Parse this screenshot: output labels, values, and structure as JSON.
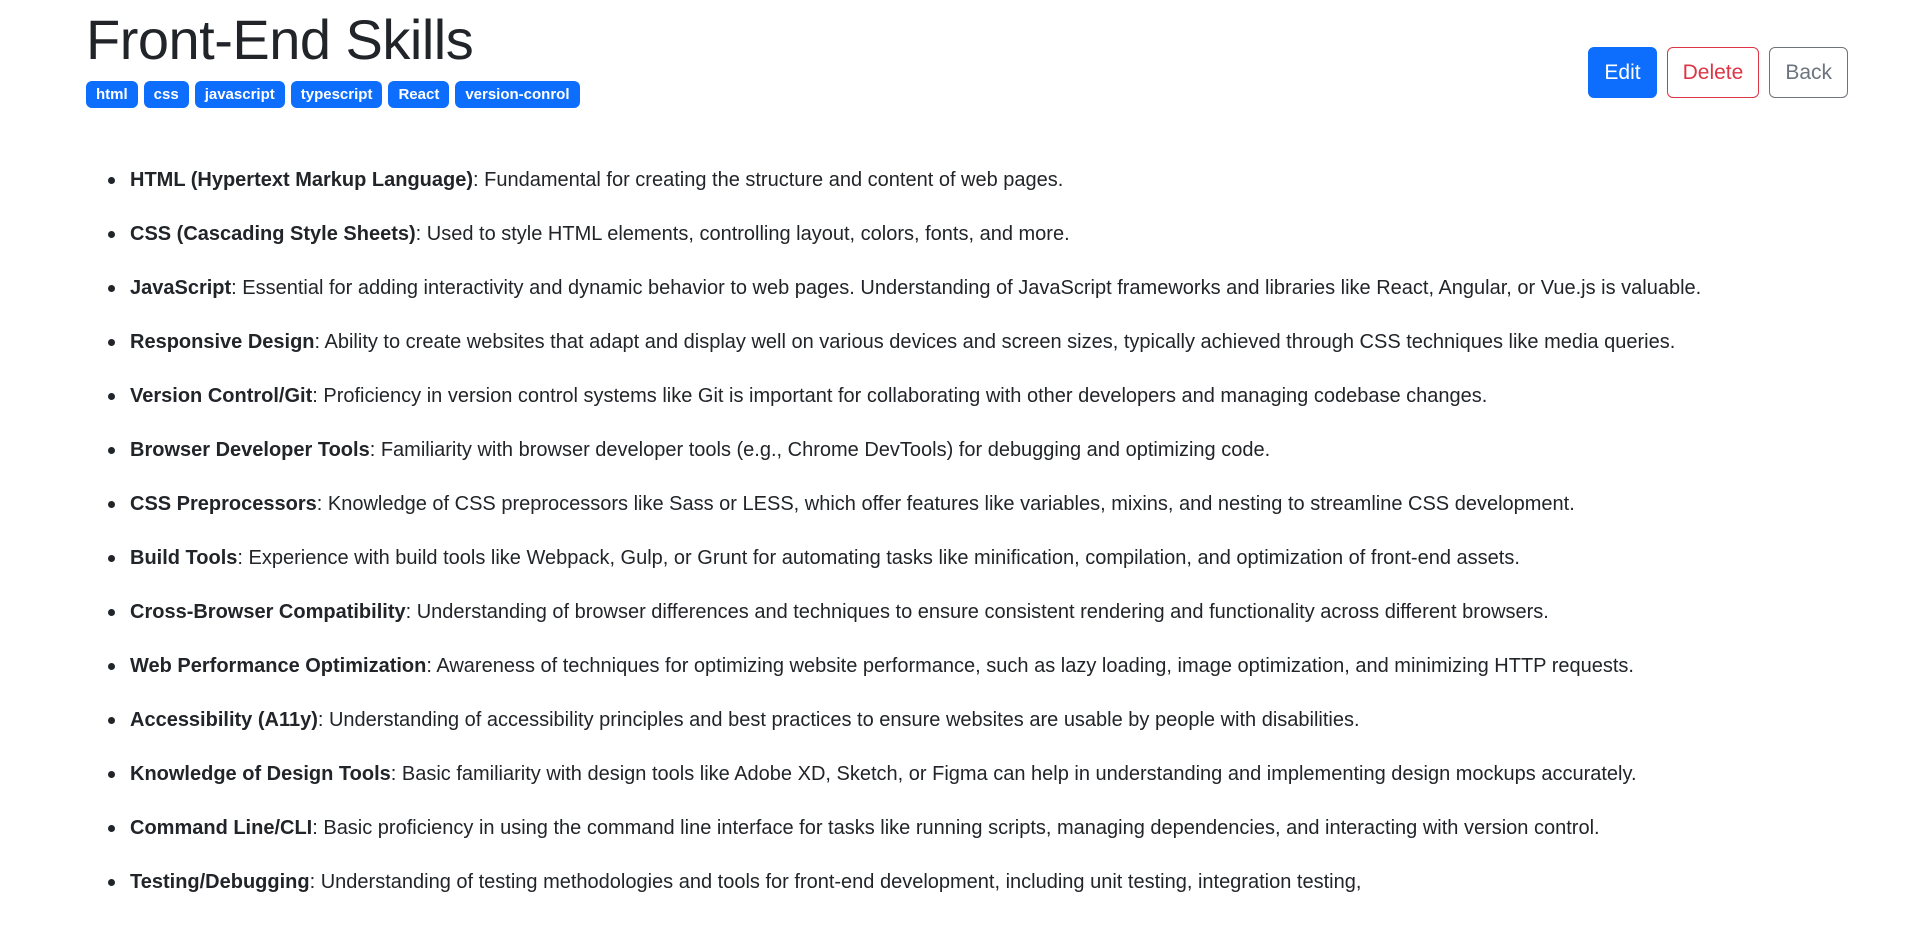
{
  "page": {
    "title": "Front-End Skills",
    "tags": [
      "html",
      "css",
      "javascript",
      "typescript",
      "React",
      "version-conrol"
    ]
  },
  "actions": {
    "edit_label": "Edit",
    "delete_label": "Delete",
    "back_label": "Back"
  },
  "skills": [
    {
      "name": "HTML (Hypertext Markup Language)",
      "description": ": Fundamental for creating the structure and content of web pages."
    },
    {
      "name": "CSS (Cascading Style Sheets)",
      "description": ": Used to style HTML elements, controlling layout, colors, fonts, and more."
    },
    {
      "name": "JavaScript",
      "description": ": Essential for adding interactivity and dynamic behavior to web pages. Understanding of JavaScript frameworks and libraries like React, Angular, or Vue.js is valuable."
    },
    {
      "name": "Responsive Design",
      "description": ": Ability to create websites that adapt and display well on various devices and screen sizes, typically achieved through CSS techniques like media queries."
    },
    {
      "name": "Version Control/Git",
      "description": ": Proficiency in version control systems like Git is important for collaborating with other developers and managing codebase changes."
    },
    {
      "name": "Browser Developer Tools",
      "description": ": Familiarity with browser developer tools (e.g., Chrome DevTools) for debugging and optimizing code."
    },
    {
      "name": "CSS Preprocessors",
      "description": ": Knowledge of CSS preprocessors like Sass or LESS, which offer features like variables, mixins, and nesting to streamline CSS development."
    },
    {
      "name": "Build Tools",
      "description": ": Experience with build tools like Webpack, Gulp, or Grunt for automating tasks like minification, compilation, and optimization of front-end assets."
    },
    {
      "name": "Cross-Browser Compatibility",
      "description": ": Understanding of browser differences and techniques to ensure consistent rendering and functionality across different browsers."
    },
    {
      "name": "Web Performance Optimization",
      "description": ": Awareness of techniques for optimizing website performance, such as lazy loading, image optimization, and minimizing HTTP requests."
    },
    {
      "name": "Accessibility (A11y)",
      "description": ": Understanding of accessibility principles and best practices to ensure websites are usable by people with disabilities."
    },
    {
      "name": "Knowledge of Design Tools",
      "description": ": Basic familiarity with design tools like Adobe XD, Sketch, or Figma can help in understanding and implementing design mockups accurately."
    },
    {
      "name": "Command Line/CLI",
      "description": ": Basic proficiency in using the command line interface for tasks like running scripts, managing dependencies, and interacting with version control."
    },
    {
      "name": "Testing/Debugging",
      "description": ": Understanding of testing methodologies and tools for front-end development, including unit testing, integration testing,"
    }
  ]
}
